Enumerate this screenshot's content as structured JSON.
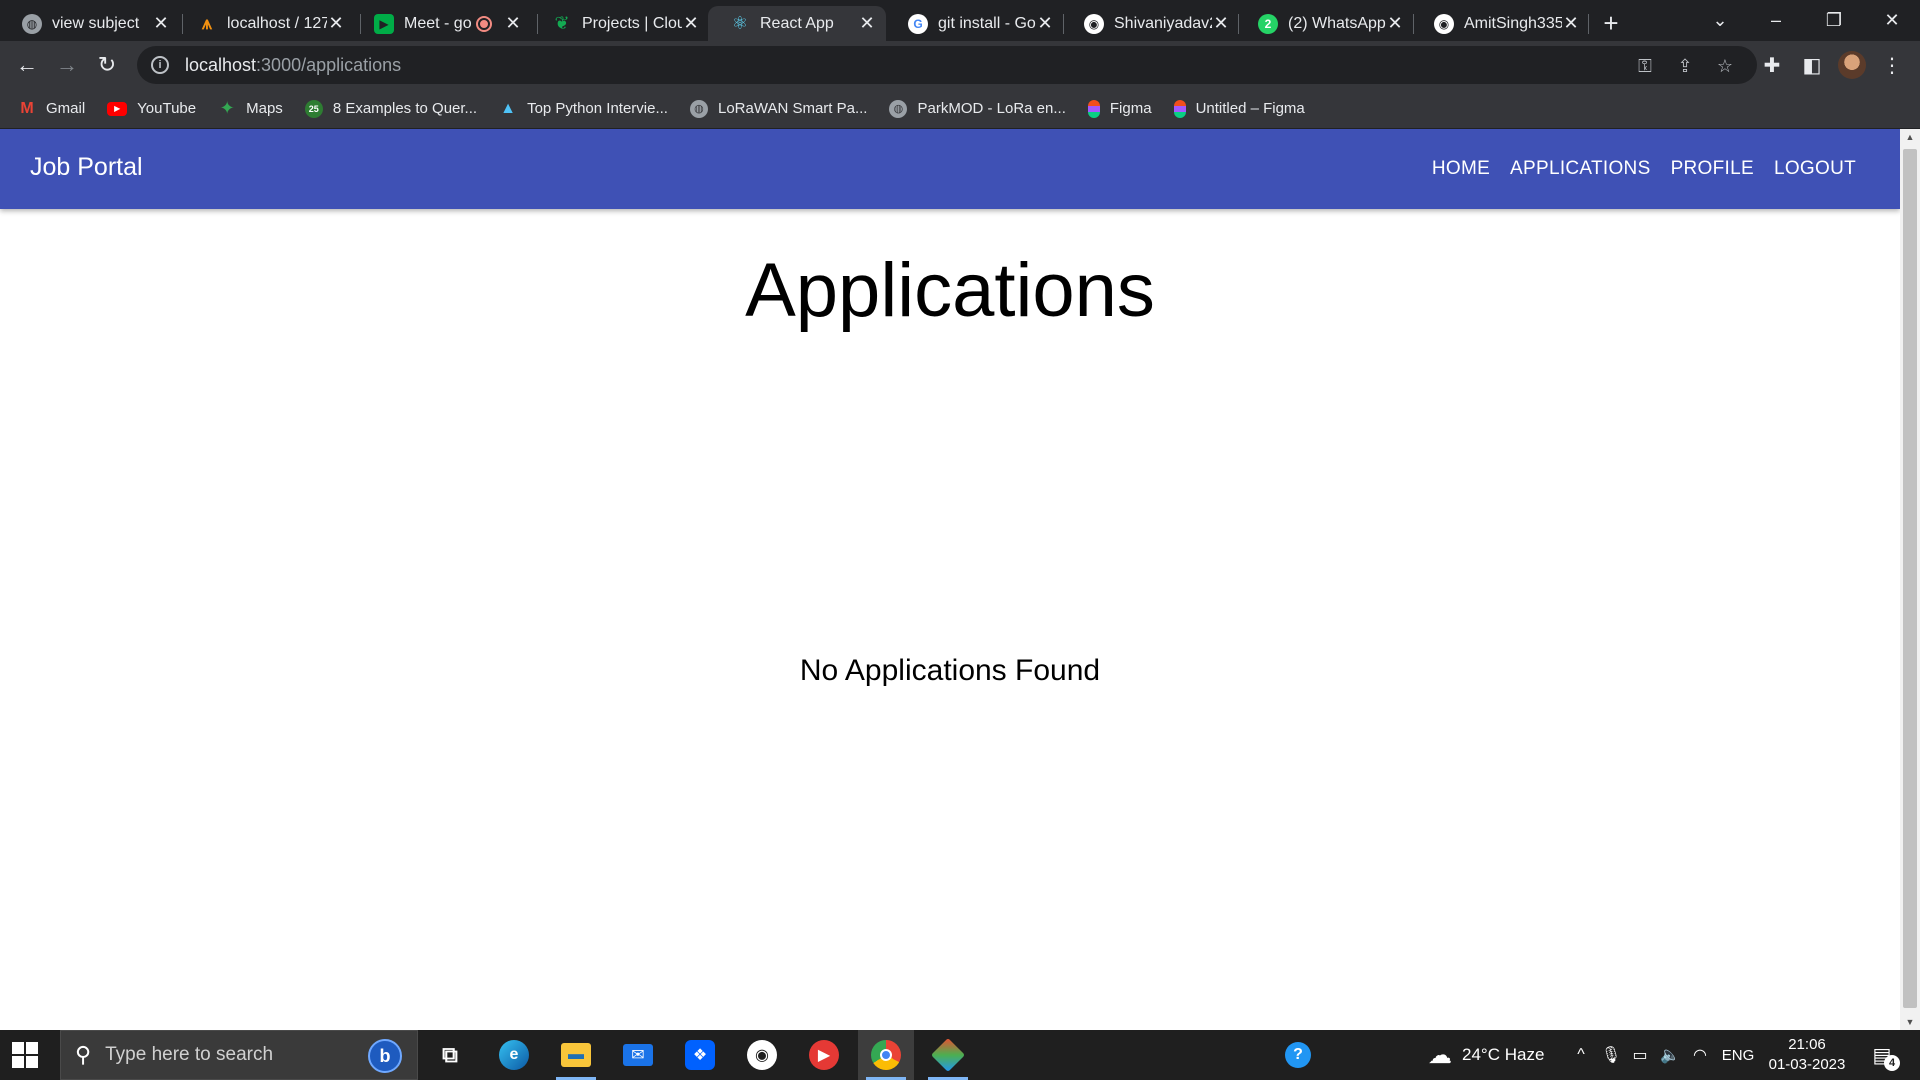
{
  "browser": {
    "tabs": [
      {
        "title": "view subject",
        "icon": "globe-icon",
        "color": "#9aa0a6"
      },
      {
        "title": "localhost / 127",
        "icon": "phpmyadmin-icon",
        "color": "#f29111"
      },
      {
        "title": "Meet - go",
        "icon": "meet-icon",
        "color": "#00ac47"
      },
      {
        "title": "Projects | Clou",
        "icon": "mongodb-leaf-icon",
        "color": "#13aa52"
      },
      {
        "title": "React App",
        "icon": "react-icon",
        "color": "#61dafb"
      },
      {
        "title": "git install - Go",
        "icon": "google-icon",
        "color": "#ffffff"
      },
      {
        "title": "Shivaniyadav2",
        "icon": "github-icon",
        "color": "#ffffff"
      },
      {
        "title": "(2) WhatsApp",
        "icon": "whatsapp-icon",
        "color": "#25d366"
      },
      {
        "title": "AmitSingh335",
        "icon": "github-icon",
        "color": "#ffffff"
      }
    ],
    "active_tab": 4,
    "address": {
      "host": "localhost",
      "path": ":3000/applications"
    },
    "bookmarks": [
      {
        "label": "Gmail",
        "icon": "gmail-icon",
        "color": "#ea4335"
      },
      {
        "label": "YouTube",
        "icon": "youtube-icon",
        "color": "#ff0000"
      },
      {
        "label": "Maps",
        "icon": "maps-icon",
        "color": "#34a853"
      },
      {
        "label": "8 Examples to Quer...",
        "icon": "site-icon",
        "color": "#2e7d32"
      },
      {
        "label": "Top Python Intervie...",
        "icon": "mountain-icon",
        "color": "#4fc3f7"
      },
      {
        "label": "LoRaWAN Smart Pa...",
        "icon": "globe-icon",
        "color": "#9aa0a6"
      },
      {
        "label": "ParkMOD - LoRa en...",
        "icon": "globe-icon",
        "color": "#9aa0a6"
      },
      {
        "label": "Figma",
        "icon": "figma-icon",
        "color": "#f24e1e"
      },
      {
        "label": "Untitled – Figma",
        "icon": "figma-icon",
        "color": "#f24e1e"
      }
    ]
  },
  "app": {
    "brand": "Job Portal",
    "nav": [
      "HOME",
      "APPLICATIONS",
      "PROFILE",
      "LOGOUT"
    ],
    "page_title": "Applications",
    "empty_message": "No Applications Found",
    "accent_color": "#3f51b5"
  },
  "taskbar": {
    "search_placeholder": "Type here to search",
    "weather": "24°C  Haze",
    "language": "ENG",
    "time": "21:06",
    "date": "01-03-2023",
    "notification_count": "4"
  }
}
